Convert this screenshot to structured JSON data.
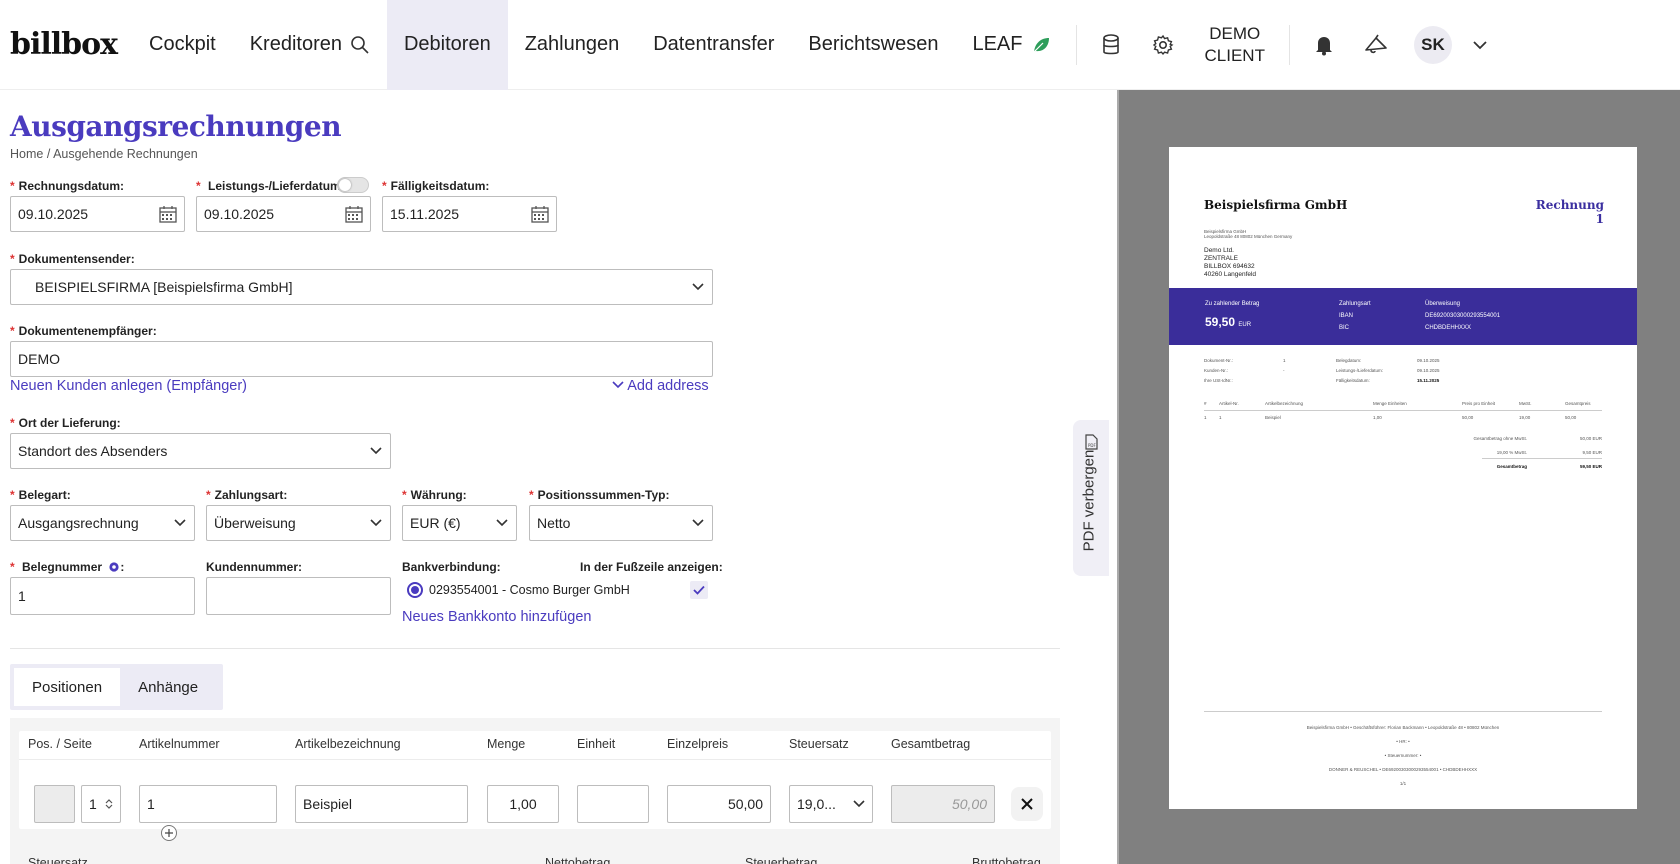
{
  "nav": {
    "logo": "billbox",
    "items": [
      "Cockpit",
      "Kreditoren",
      "Debitoren",
      "Zahlungen",
      "Datentransfer",
      "Berichtswesen",
      "LEAF"
    ],
    "client_line1": "DEMO",
    "client_line2": "CLIENT",
    "avatar": "SK",
    "icons": [
      "search-icon",
      "leaf-icon",
      "database-icon",
      "gear-icon",
      "bell-icon",
      "megaphone-icon",
      "chevron-down-icon"
    ]
  },
  "page": {
    "title": "Ausgangsrechnungen",
    "breadcrumb": "Home / Ausgehende Rechnungen"
  },
  "form": {
    "rechnungsdatum_label": "Rechnungsdatum:",
    "rechnungsdatum": "09.10.2025",
    "leistungsdatum_label": "Leistungs-/Lieferdatum",
    "leistungsdatum": "09.10.2025",
    "faelligkeitsdatum_label": "Fälligkeitsdatum:",
    "faelligkeitsdatum": "15.11.2025",
    "sender_label": "Dokumentensender:",
    "sender": "BEISPIELSFIRMA [Beispielsfirma GmbH]",
    "recipient_label": "Dokumentenempfänger:",
    "recipient": "DEMO",
    "new_customer_link": "Neuen Kunden anlegen (Empfänger)",
    "add_address_link": "Add address",
    "ort_label": "Ort der Lieferung:",
    "ort": "Standort des Absenders",
    "belegart_label": "Belegart:",
    "belegart": "Ausgangsrechnung",
    "zahlungsart_label": "Zahlungsart:",
    "zahlungsart": "Überweisung",
    "waehrung_label": "Währung:",
    "waehrung": "EUR (€)",
    "summentyp_label": "Positionssummen-Typ:",
    "summentyp": "Netto",
    "belegnummer_label": "Belegnummer",
    "belegnummer": "1",
    "kundennummer_label": "Kundennummer:",
    "kundennummer": "",
    "bank_label": "Bankverbindung:",
    "footer_label": "In der Fußzeile anzeigen:",
    "bank_account": "0293554001 - Cosmo Burger GmbH",
    "new_bank_link": "Neues Bankkonto hinzufügen"
  },
  "tabs": [
    "Positionen",
    "Anhänge"
  ],
  "positions": {
    "headers": [
      "Pos. / Seite",
      "Artikelnummer",
      "Artikelbezeichnung",
      "Menge",
      "Einheit",
      "Einzelpreis",
      "Steuersatz",
      "Gesamtbetrag"
    ],
    "row": {
      "pos": "1",
      "artikelnummer": "1",
      "bezeichnung": "Beispiel",
      "menge": "1,00",
      "einheit": "",
      "einzelpreis": "50,00",
      "steuersatz": "19,0...",
      "gesamt": "50,00"
    },
    "summary_headers": [
      "Steuersatz",
      "Nettobetrag",
      "Steuerbetrag",
      "Bruttobetrag"
    ]
  },
  "side_tab": "PDF verbergen",
  "preview": {
    "company": "Beispielsfirma GmbH",
    "invoice_title": "Rechnung 1",
    "sender_line1": "Beispielsfirma GmbH",
    "sender_line2": "Leopoldstraße 48 80802 München Germany",
    "recipient_lines": [
      "Demo Ltd.",
      "ZENTRALE",
      "BILLBOX 694632",
      "40260 Langenfeld"
    ],
    "band": {
      "amount_label": "Zu zahlender Betrag",
      "amount": "59,50",
      "currency": "EUR",
      "payment_label": "Zahlungsart",
      "iban_label": "IBAN",
      "bic_label": "BIC",
      "method": "Überweisung",
      "iban": "DE69200303000293554001",
      "bic": "CHDBDEHHXXX"
    },
    "meta": [
      [
        "Dokument-Nr.:",
        "1",
        "Belegdatum:",
        "09.10.2025"
      ],
      [
        "Kunden-Nr.:",
        "-",
        "Leistungs-/Lieferdatum:",
        "09.10.2025"
      ],
      [
        "Ihre USt-IdNr.:",
        "",
        "Fälligkeitsdatum:",
        "15.11.2025"
      ]
    ],
    "table_headers": [
      "#",
      "Artikel-Nr.",
      "Artikelbezeichnung",
      "Menge",
      "Einheiten",
      "Preis pro Einheit",
      "MwSt.",
      "Gesamtpreis"
    ],
    "table_row": [
      "1",
      "1",
      "Beispiel",
      "1,00",
      "",
      "50,00",
      "19,00",
      "50,00"
    ],
    "totals": [
      [
        "Gesamtbetrag ohne MwSt.",
        "50,00 EUR"
      ],
      [
        "19,00 % MwSt.",
        "9,50 EUR"
      ],
      [
        "Gesamtbetrag",
        "59,50 EUR"
      ]
    ],
    "footer_lines": [
      "Beispielsfirma GmbH • Geschäftsführer: Florian Backmann • Leopoldstraße 48 • 80802 München",
      "• HR: •",
      "• Steuernummer: •",
      "DONNER & REUSCHEL • DE69200303000293554001 • CHDBDEHHXXX",
      "1/1"
    ]
  }
}
